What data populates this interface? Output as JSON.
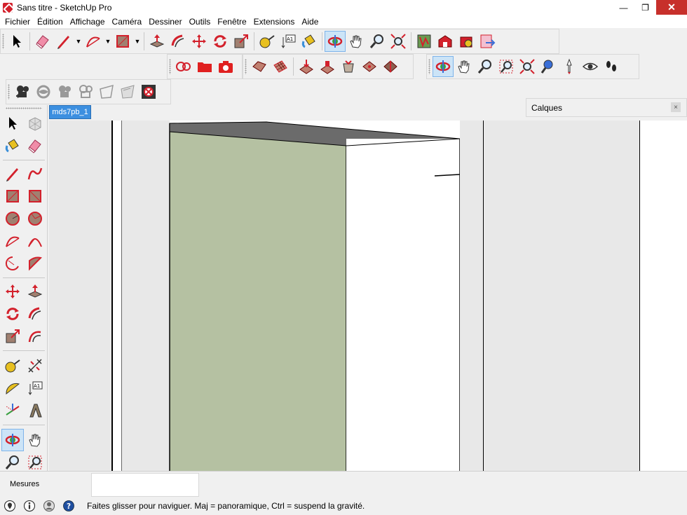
{
  "window": {
    "title": "Sans titre - SketchUp Pro",
    "minimize": "—",
    "maximize": "❐",
    "close": "✕"
  },
  "menu": {
    "items": [
      {
        "label": "Fichier"
      },
      {
        "label": "Édition"
      },
      {
        "label": "Affichage"
      },
      {
        "label": "Caméra"
      },
      {
        "label": "Dessiner"
      },
      {
        "label": "Outils"
      },
      {
        "label": "Fenêtre"
      },
      {
        "label": "Extensions"
      },
      {
        "label": "Aide"
      }
    ]
  },
  "scene_tab": {
    "label": "mds7pb_1"
  },
  "layers_panel": {
    "title": "Calques",
    "close": "×"
  },
  "measurements": {
    "label": "Mesures",
    "value": ""
  },
  "status": {
    "text": "Faites glisser pour naviguer. Maj = panoramique, Ctrl =  suspend la gravité."
  },
  "colors": {
    "accent": "#3c8fe0",
    "wall_green": "#b5c1a2",
    "roof_gray": "#6b6b6b",
    "tool_red": "#d3212c",
    "tool_active_bg": "#cce4f7"
  },
  "icons": {
    "select": "select-arrow-icon",
    "eraser": "eraser-icon",
    "pencil": "pencil-line-icon",
    "arc": "arc-icon",
    "rectangle": "rectangle-icon",
    "pushpull": "push-pull-icon",
    "followme": "follow-me-icon",
    "move": "move-icon",
    "rotate": "rotate-icon",
    "scale": "scale-icon",
    "tape": "tape-measure-icon",
    "text": "text-icon",
    "paint": "paint-bucket-icon",
    "orbit": "orbit-icon",
    "pan": "pan-hand-icon",
    "zoom": "zoom-icon",
    "zoom_extents": "zoom-extents-icon"
  }
}
